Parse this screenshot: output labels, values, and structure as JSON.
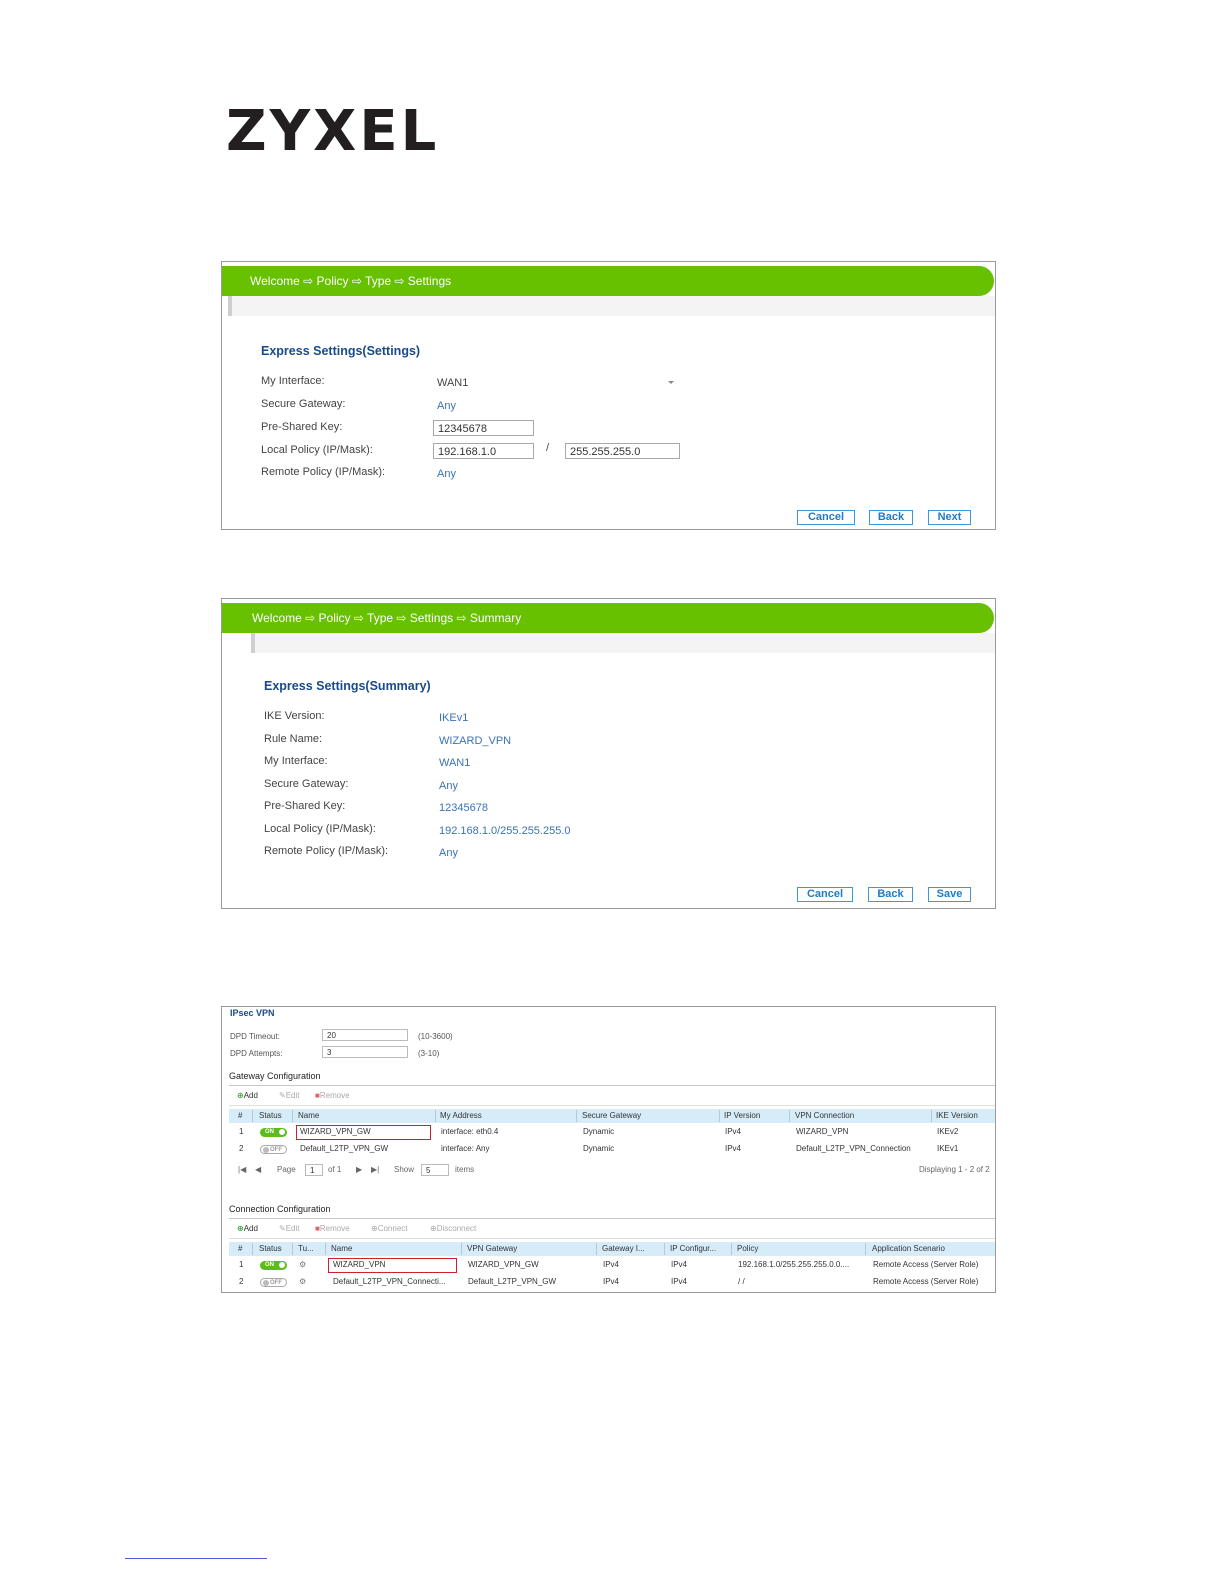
{
  "logo": "ZYXEL",
  "settings": {
    "breadcrumb": "Welcome ⇨ Policy ⇨ Type ⇨ Settings",
    "title": "Express Settings(Settings)",
    "labels": {
      "my_interface": "My Interface:",
      "secure_gateway": "Secure Gateway:",
      "pre_shared_key": "Pre-Shared Key:",
      "local_policy": "Local Policy (IP/Mask):",
      "remote_policy": "Remote Policy (IP/Mask):"
    },
    "values": {
      "my_interface": "WAN1",
      "secure_gateway": "Any",
      "pre_shared_key": "12345678",
      "local_ip": "192.168.1.0",
      "slash": "/",
      "local_mask": "255.255.255.0",
      "remote_policy": "Any"
    },
    "buttons": {
      "cancel": "Cancel",
      "back": "Back",
      "next": "Next"
    }
  },
  "summary": {
    "breadcrumb": "Welcome ⇨ Policy ⇨ Type ⇨ Settings ⇨ Summary",
    "title": "Express Settings(Summary)",
    "rows": [
      {
        "label": "IKE Version:",
        "value": "IKEv1"
      },
      {
        "label": "Rule Name:",
        "value": "WIZARD_VPN"
      },
      {
        "label": "My Interface:",
        "value": "WAN1"
      },
      {
        "label": "Secure Gateway:",
        "value": "Any"
      },
      {
        "label": "Pre-Shared Key:",
        "value": "12345678"
      },
      {
        "label": "Local Policy (IP/Mask):",
        "value": "192.168.1.0/255.255.255.0"
      },
      {
        "label": "Remote Policy (IP/Mask):",
        "value": "Any"
      }
    ],
    "buttons": {
      "cancel": "Cancel",
      "back": "Back",
      "save": "Save"
    }
  },
  "ipsec": {
    "title": "IPsec VPN",
    "dpd_timeout_label": "DPD Timeout:",
    "dpd_timeout_value": "20",
    "dpd_timeout_range": "(10-3600)",
    "dpd_attempts_label": "DPD Attempts:",
    "dpd_attempts_value": "3",
    "dpd_attempts_range": "(3-10)",
    "gateway": {
      "section": "Gateway Configuration",
      "toolbar": {
        "add": "Add",
        "edit": "Edit",
        "remove": "Remove"
      },
      "columns": [
        "#",
        "Status",
        "Name",
        "My Address",
        "Secure Gateway",
        "IP Version",
        "VPN Connection",
        "IKE Version"
      ],
      "rows": [
        {
          "n": "1",
          "status": "ON",
          "name": "WIZARD_VPN_GW",
          "my_address": "interface: eth0.4",
          "secure_gateway": "Dynamic",
          "ip_version": "IPv4",
          "vpn_connection": "WIZARD_VPN",
          "ike": "IKEv2"
        },
        {
          "n": "2",
          "status": "OFF",
          "name": "Default_L2TP_VPN_GW",
          "my_address": "interface: Any",
          "secure_gateway": "Dynamic",
          "ip_version": "IPv4",
          "vpn_connection": "Default_L2TP_VPN_Connection",
          "ike": "IKEv1"
        }
      ],
      "pager": {
        "page_label": "Page",
        "page_value": "1",
        "of": "of 1",
        "show": "Show",
        "show_value": "5",
        "items": "items",
        "displaying": "Displaying 1 - 2 of 2"
      }
    },
    "connection": {
      "section": "Connection Configuration",
      "toolbar": {
        "add": "Add",
        "edit": "Edit",
        "remove": "Remove",
        "connect": "Connect",
        "disconnect": "Disconnect"
      },
      "columns": [
        "#",
        "Status",
        "Tu...",
        "Name",
        "VPN Gateway",
        "Gateway I...",
        "IP Configur...",
        "Policy",
        "Application Scenario"
      ],
      "rows": [
        {
          "n": "1",
          "status": "ON",
          "name": "WIZARD_VPN",
          "gateway": "WIZARD_VPN_GW",
          "gw_ip": "IPv4",
          "ip_conf": "IPv4",
          "policy": "192.168.1.0/255.255.255.0.0....",
          "scenario": "Remote Access (Server Role)"
        },
        {
          "n": "2",
          "status": "OFF",
          "name": "Default_L2TP_VPN_Connecti...",
          "gateway": "Default_L2TP_VPN_GW",
          "gw_ip": "IPv4",
          "ip_conf": "IPv4",
          "policy": "/ /",
          "scenario": "Remote Access (Server Role)"
        }
      ]
    }
  },
  "colors": {
    "wizard_green": "#67c000",
    "title_blue": "#1a4a8a",
    "value_blue": "#3a72b5",
    "button_blue": "#1e7bc6",
    "highlight_red": "#d0202a",
    "header_blue": "#d6ecf9"
  }
}
